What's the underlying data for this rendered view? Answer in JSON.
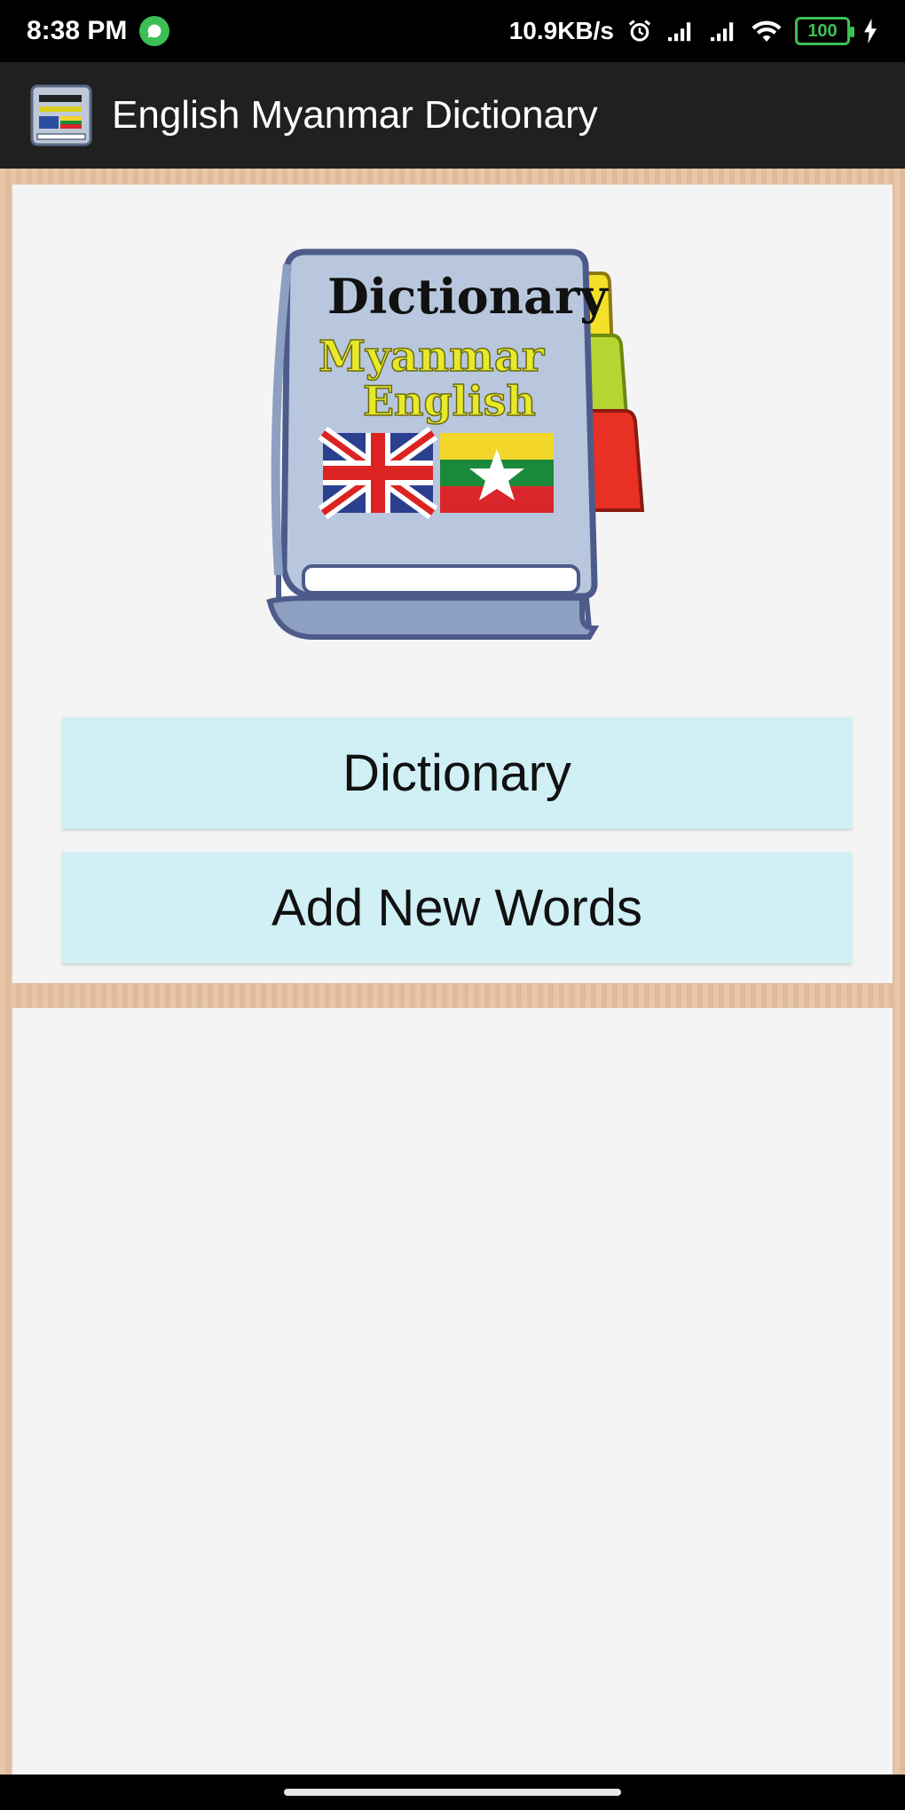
{
  "status_bar": {
    "time": "8:38 PM",
    "network_speed": "10.9KB/s",
    "battery_level": "100",
    "icons": [
      "whatsapp-icon",
      "alarm-icon",
      "signal-icon",
      "signal-icon",
      "wifi-icon",
      "battery-icon",
      "charging-icon"
    ]
  },
  "app_bar": {
    "title": "English Myanmar Dictionary",
    "icon": "dictionary-app-icon"
  },
  "logo": {
    "line1": "Dictionary",
    "line2": "Myanmar",
    "line3": "English"
  },
  "buttons": {
    "dictionary": "Dictionary",
    "add_new_words": "Add New Words"
  },
  "colors": {
    "app_bar": "#202020",
    "wood": "#e7c3a2",
    "panel": "#f4f4f4",
    "button": "#d0f0f6"
  }
}
